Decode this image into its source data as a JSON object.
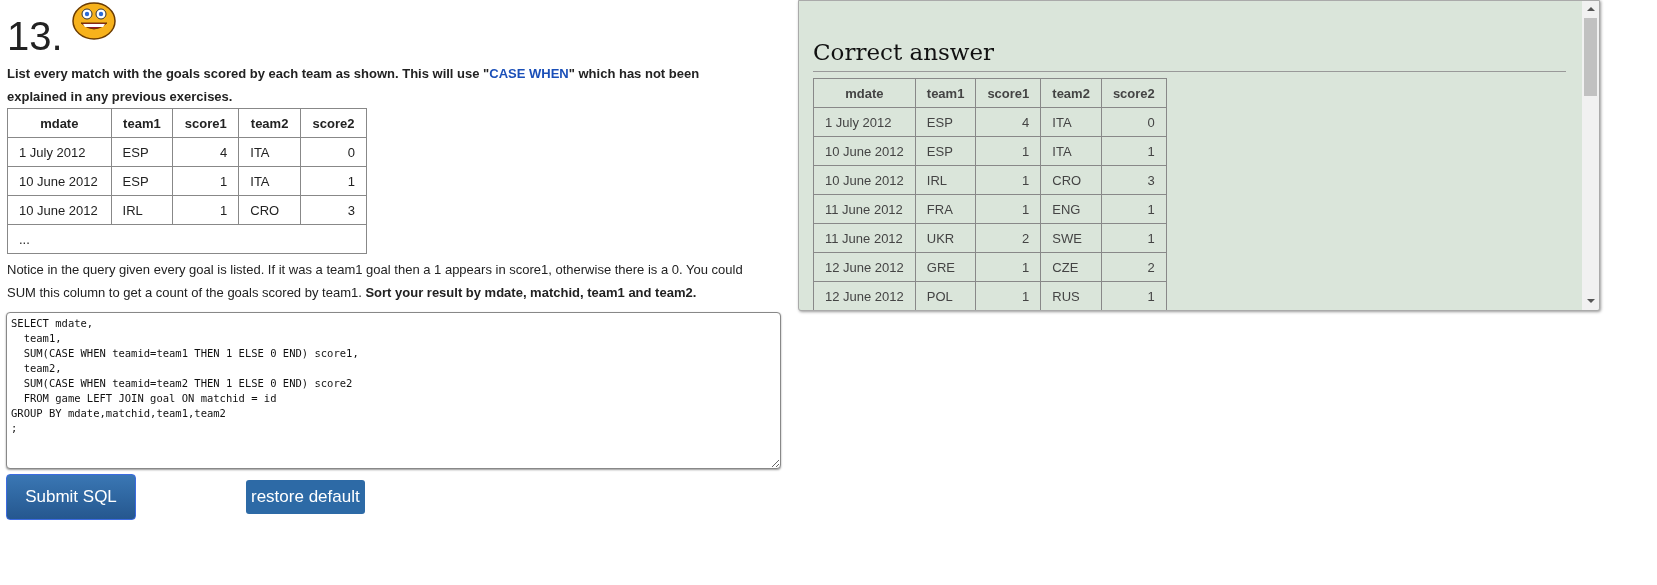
{
  "question": {
    "number": "13.",
    "intro": [
      {
        "kind": "plain",
        "text": "List every match with the goals scored by each team as shown. This will use \""
      },
      {
        "kind": "keyword",
        "text": "CASE WHEN"
      },
      {
        "kind": "plain",
        "text": "\" which has not been explained in any previous exercises."
      }
    ],
    "example_table": {
      "columns": [
        {
          "label": "mdate",
          "numeric": false
        },
        {
          "label": "team1",
          "numeric": false
        },
        {
          "label": "score1",
          "numeric": true
        },
        {
          "label": "team2",
          "numeric": false
        },
        {
          "label": "score2",
          "numeric": true
        }
      ],
      "rows": [
        [
          "1 July 2012",
          "ESP",
          "4",
          "ITA",
          "0"
        ],
        [
          "10 June 2012",
          "ESP",
          "1",
          "ITA",
          "1"
        ],
        [
          "10 June 2012",
          "IRL",
          "1",
          "CRO",
          "3"
        ]
      ],
      "more": "..."
    },
    "notice": "Notice in the query given every goal is listed. If it was a team1 goal then a 1 appears in score1, otherwise there is a 0. You could SUM this column to get a count of the goals scored by team1. **Sort your result by mdate, matchid, team1 and team2.**",
    "sql": "SELECT mdate,\n  team1,\n  SUM(CASE WHEN teamid=team1 THEN 1 ELSE 0 END) score1,\n  team2,\n  SUM(CASE WHEN teamid=team2 THEN 1 ELSE 0 END) score2\n  FROM game LEFT JOIN goal ON matchid = id\nGROUP BY mdate,matchid,team1,team2\n;",
    "buttons": [
      {
        "kind": "primary",
        "label": "Submit SQL"
      },
      {
        "kind": "secondary",
        "label": "restore default"
      }
    ]
  },
  "answer": {
    "title": "Correct answer",
    "columns": [
      {
        "label": "mdate",
        "numeric": false
      },
      {
        "label": "team1",
        "numeric": false
      },
      {
        "label": "score1",
        "numeric": true
      },
      {
        "label": "team2",
        "numeric": false
      },
      {
        "label": "score2",
        "numeric": true
      }
    ],
    "rows": [
      [
        "1 July 2012",
        "ESP",
        "4",
        "ITA",
        "0"
      ],
      [
        "10 June 2012",
        "ESP",
        "1",
        "ITA",
        "1"
      ],
      [
        "10 June 2012",
        "IRL",
        "1",
        "CRO",
        "3"
      ],
      [
        "11 June 2012",
        "FRA",
        "1",
        "ENG",
        "1"
      ],
      [
        "11 June 2012",
        "UKR",
        "2",
        "SWE",
        "1"
      ],
      [
        "12 June 2012",
        "GRE",
        "1",
        "CZE",
        "2"
      ],
      [
        "12 June 2012",
        "POL",
        "1",
        "RUS",
        "1"
      ]
    ]
  }
}
